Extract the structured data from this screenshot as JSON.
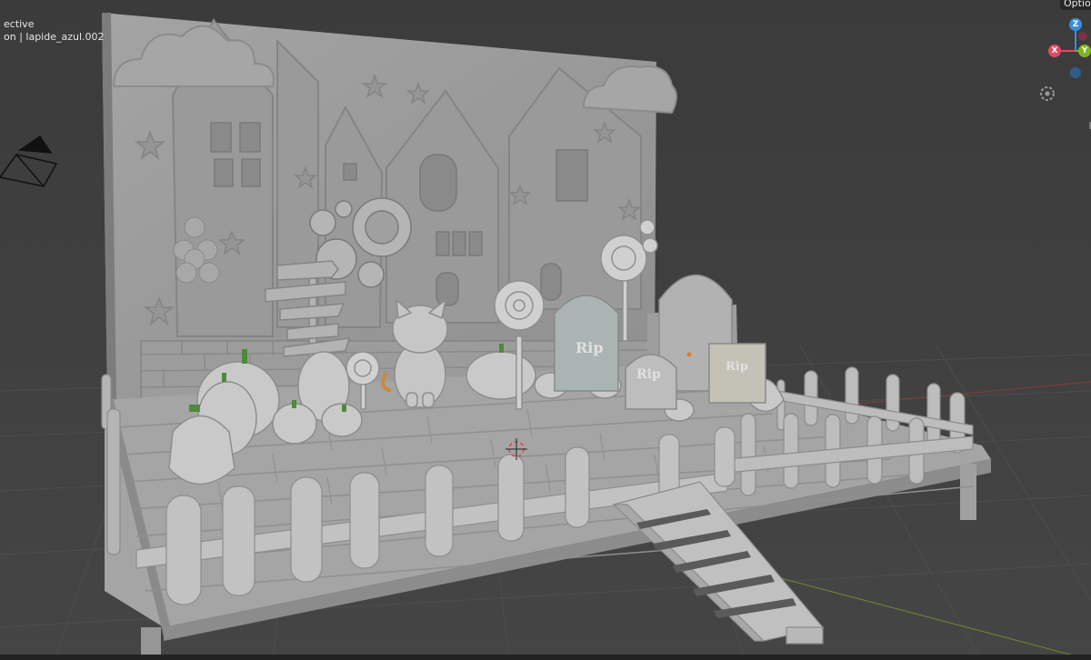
{
  "viewport": {
    "view_mode": "ective",
    "object_info": "on | lapide_azul.002",
    "options_label": "Optio"
  },
  "gizmo": {
    "z_label": "Z",
    "x_label": "X",
    "y_label": "Y",
    "colors": {
      "x": "#e04a5f",
      "y": "#7fb520",
      "z": "#3a8ede"
    }
  },
  "model": {
    "lapide_labels": [
      "Rip",
      "Rip",
      "Rip"
    ]
  },
  "icons": [
    "camera-icon",
    "gear-icon",
    "cursor-3d-icon"
  ]
}
